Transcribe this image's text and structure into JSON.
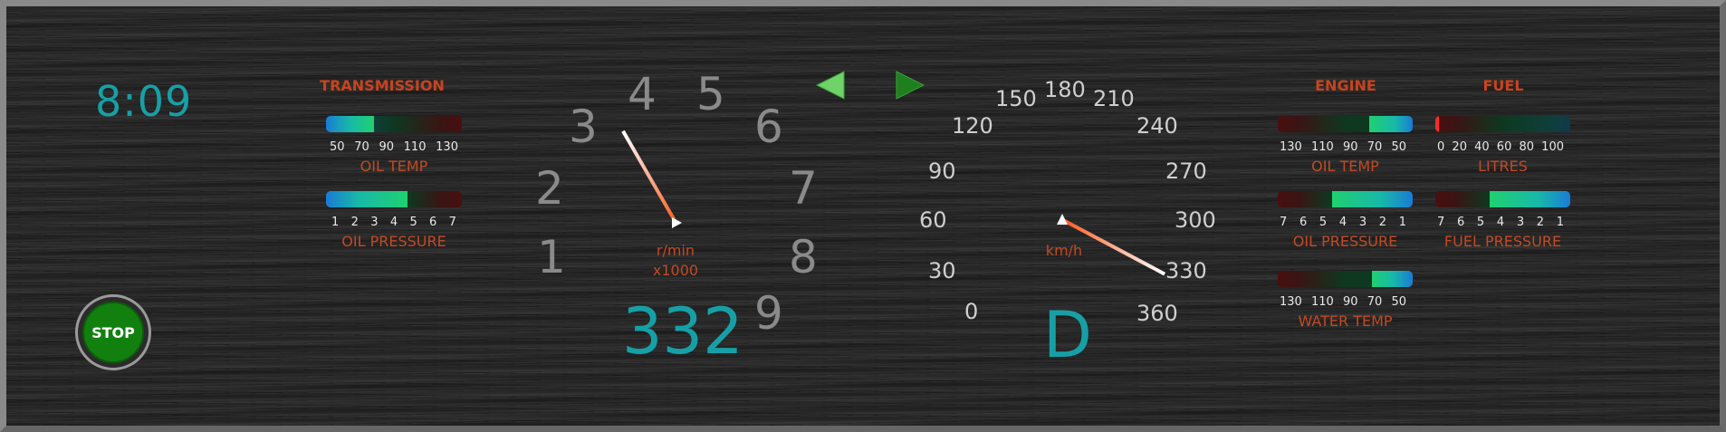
{
  "clock": "8:09",
  "stop_label": "STOP",
  "transmission": {
    "title": "TRANSMISSION",
    "oil_temp": {
      "label": "OIL TEMP",
      "ticks": [
        "50",
        "70",
        "90",
        "110",
        "130"
      ]
    },
    "oil_pressure": {
      "label": "OIL PRESSURE",
      "ticks": [
        "1",
        "2",
        "3",
        "4",
        "5",
        "6",
        "7"
      ]
    }
  },
  "tach": {
    "numerals": [
      "1",
      "2",
      "3",
      "4",
      "5",
      "6",
      "7",
      "8",
      "9"
    ],
    "unit_line1": "r/min",
    "unit_line2": "x1000",
    "readout": "332"
  },
  "indicators": {
    "left_arrow": "left-turn-indicator",
    "right_arrow": "right-turn-indicator"
  },
  "speedo": {
    "numerals": [
      "0",
      "30",
      "60",
      "90",
      "120",
      "150",
      "180",
      "210",
      "240",
      "270",
      "300",
      "330",
      "360"
    ],
    "unit": "km/h",
    "gear": "D"
  },
  "engine": {
    "title": "ENGINE",
    "oil_temp": {
      "label": "OIL TEMP",
      "ticks": [
        "130",
        "110",
        "90",
        "70",
        "50"
      ]
    },
    "oil_pressure": {
      "label": "OIL PRESSURE",
      "ticks": [
        "7",
        "6",
        "5",
        "4",
        "3",
        "2",
        "1"
      ]
    },
    "water_temp": {
      "label": "WATER TEMP",
      "ticks": [
        "130",
        "110",
        "90",
        "70",
        "50"
      ]
    }
  },
  "fuel": {
    "title": "FUEL",
    "litres": {
      "label": "LITRES",
      "ticks": [
        "0",
        "20",
        "40",
        "60",
        "80",
        "100"
      ]
    },
    "fuel_pressure": {
      "label": "FUEL PRESSURE",
      "ticks": [
        "7",
        "6",
        "5",
        "4",
        "3",
        "2",
        "1"
      ]
    }
  },
  "colors": {
    "accent": "#16a0a6",
    "label": "#c24a24",
    "stop": "#12800f",
    "needle": "#ff6a2e"
  }
}
